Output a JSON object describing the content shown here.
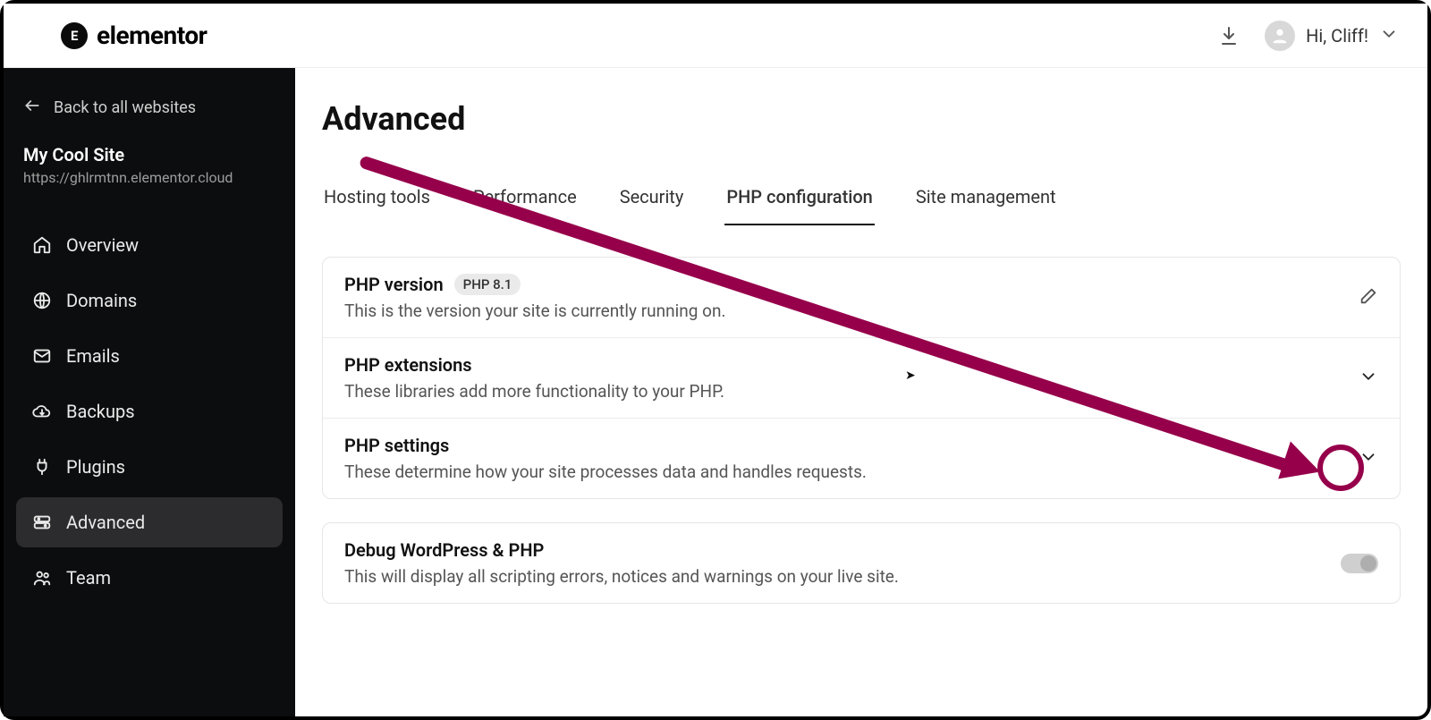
{
  "header": {
    "brand": "elementor",
    "greeting": "Hi, Cliff!"
  },
  "sidebar": {
    "back_label": "Back to all websites",
    "site_name": "My Cool Site",
    "site_url": "https://ghlrmtnn.elementor.cloud",
    "items": [
      {
        "label": "Overview"
      },
      {
        "label": "Domains"
      },
      {
        "label": "Emails"
      },
      {
        "label": "Backups"
      },
      {
        "label": "Plugins"
      },
      {
        "label": "Advanced"
      },
      {
        "label": "Team"
      }
    ]
  },
  "main": {
    "title": "Advanced",
    "tabs": [
      {
        "label": "Hosting tools"
      },
      {
        "label": "Performance"
      },
      {
        "label": "Security"
      },
      {
        "label": "PHP configuration"
      },
      {
        "label": "Site management"
      }
    ],
    "active_tab_index": 3,
    "group1": [
      {
        "title": "PHP version",
        "badge": "PHP 8.1",
        "subtitle": "This is the version your site is currently running on.",
        "action": "edit"
      },
      {
        "title": "PHP extensions",
        "subtitle": "These libraries add more functionality to your PHP.",
        "action": "expand"
      },
      {
        "title": "PHP settings",
        "subtitle": "These determine how your site processes data and handles requests.",
        "action": "expand"
      }
    ],
    "group2": [
      {
        "title": "Debug WordPress & PHP",
        "subtitle": "This will display all scripting errors, notices and warnings on your live site.",
        "action": "toggle",
        "toggle_on": false
      }
    ]
  }
}
